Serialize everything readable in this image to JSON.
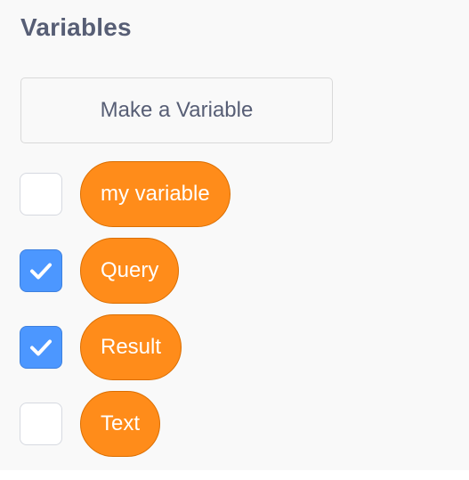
{
  "palette": {
    "category_title": "Variables",
    "make_variable_label": "Make a Variable",
    "variables": [
      {
        "label": "my variable",
        "checked": false
      },
      {
        "label": "Query",
        "checked": true
      },
      {
        "label": "Result",
        "checked": true
      },
      {
        "label": "Text",
        "checked": false
      }
    ]
  },
  "colors": {
    "variable_block": "#ff8c1a",
    "variable_block_border": "#db6e00",
    "checkbox_checked": "#4c97ff",
    "category_title": "#575e75",
    "palette_background": "#f9f9f9"
  }
}
